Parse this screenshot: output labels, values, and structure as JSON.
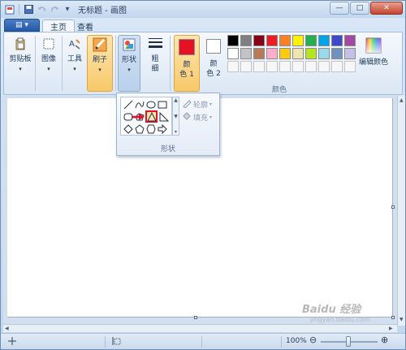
{
  "window": {
    "title": "无标题 - 画图",
    "controls": {
      "minimize": "—",
      "maximize": "□",
      "close": "✕"
    }
  },
  "quick_access": {
    "save_icon": "save-icon",
    "undo_icon": "undo-icon",
    "redo_icon": "redo-icon",
    "customize": "▾"
  },
  "app_menu": {
    "label": "▤ ▾"
  },
  "tabs": [
    {
      "label": "主页",
      "active": true
    },
    {
      "label": "查看",
      "active": false
    }
  ],
  "ribbon": {
    "clipboard": {
      "label": "剪贴板",
      "icon": "clipboard-icon"
    },
    "image": {
      "label": "图像",
      "icon": "image-select-icon"
    },
    "tools": {
      "label": "工具",
      "icon": "tools-icon"
    },
    "brushes": {
      "label": "刷子",
      "icon": "brush-icon"
    },
    "shapes": {
      "label": "形状",
      "icon": "shapes-icon"
    },
    "size": {
      "label_line1": "粗",
      "label_line2": "细"
    },
    "color1": {
      "label_line1": "颜",
      "label_line2": "色 1",
      "value": "#e81123"
    },
    "color2": {
      "label_line1": "颜",
      "label_line2": "色 2",
      "value": "#ffffff"
    },
    "colors_group_label": "颜色",
    "edit_colors": {
      "label": "编辑颜色",
      "icon": "color-wheel-icon"
    },
    "palette_row1": [
      "#000000",
      "#7f7f7f",
      "#880015",
      "#ed1c24",
      "#ff7f27",
      "#fff200",
      "#22b14c",
      "#00a2e8",
      "#3f48cc",
      "#a349a4"
    ],
    "palette_row2": [
      "#ffffff",
      "#c3c3c3",
      "#b97a57",
      "#ffaec9",
      "#ffc90e",
      "#efe4b0",
      "#b5e61d",
      "#99d9ea",
      "#7092be",
      "#c8bfe7"
    ]
  },
  "shapes_dropdown": {
    "group_label": "形状",
    "outline_label": "轮廓",
    "fill_label": "填充",
    "selected_shape": "triangle"
  },
  "statusbar": {
    "zoom": "100%",
    "zoom_out": "⊖",
    "zoom_in": "⊕"
  },
  "watermark": {
    "text": "Baidu 经验",
    "url": "jingyan.baidu.com"
  },
  "colors": {
    "accent": "#e3a43a",
    "highlight": "#e81123"
  }
}
